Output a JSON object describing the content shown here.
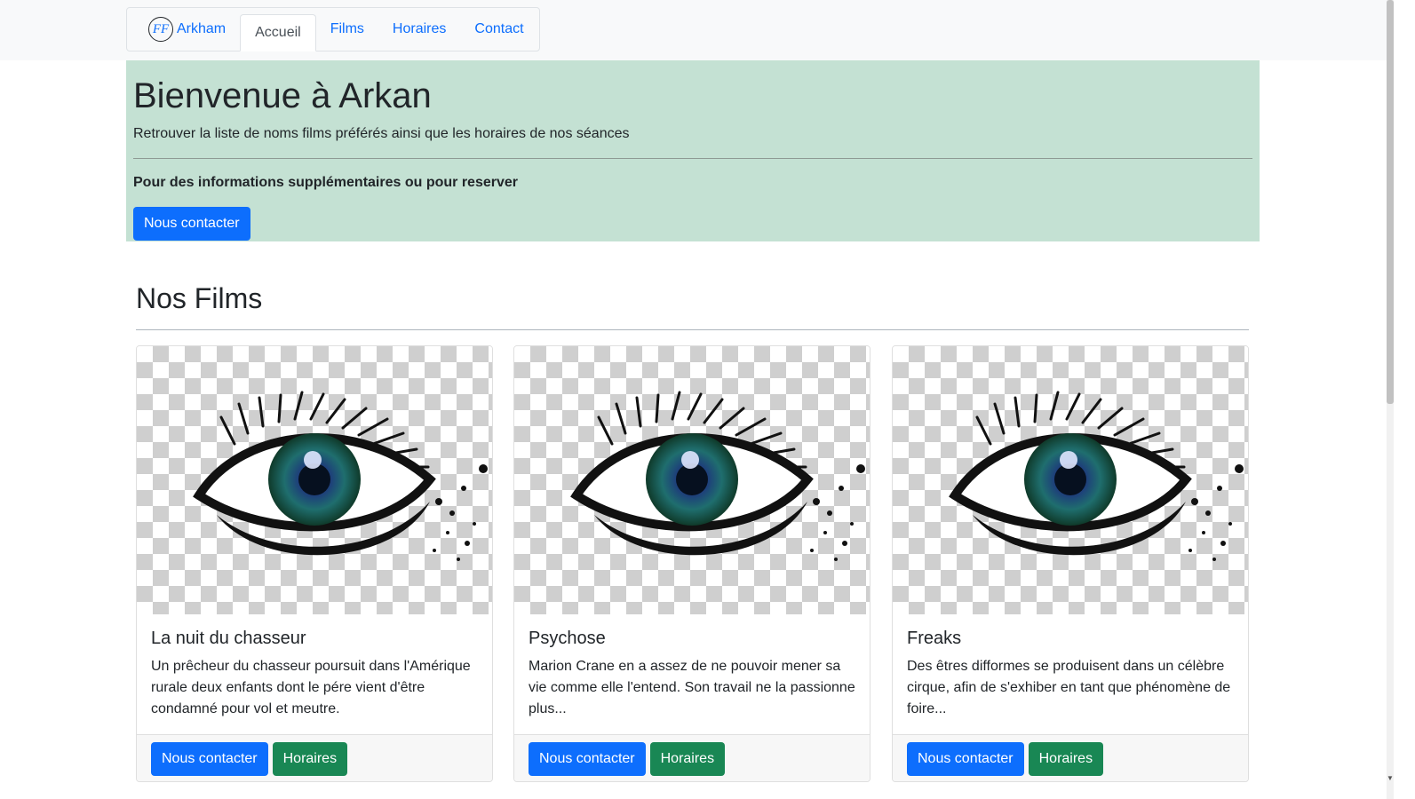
{
  "nav": {
    "brand_logo": "FF",
    "brand_label": "Arkham",
    "links": [
      "Accueil",
      "Films",
      "Horaires",
      "Contact"
    ]
  },
  "hero": {
    "title": "Bienvenue à Arkan",
    "lead": "Retrouver la liste de noms films préférés ainsi que les horaires de nos séances",
    "info": "Pour des informations supplémentaires ou pour reserver",
    "button": "Nous contacter",
    "background_color": "#c4e1d3"
  },
  "films_section": {
    "title": "Nos Films",
    "cards": [
      {
        "title": "La nuit du chasseur",
        "text": "Un prêcheur du chasseur poursuit dans l'Amérique rurale deux enfants dont le pére vient d'être condamné pour vol et meutre.",
        "contact_button": "Nous contacter",
        "schedule_button": "Horaires",
        "image_icon": "eye-image"
      },
      {
        "title": "Psychose",
        "text": "Marion Crane en a assez de ne pouvoir mener sa vie comme elle l'entend. Son travail ne la passionne plus...",
        "contact_button": "Nous contacter",
        "schedule_button": "Horaires",
        "image_icon": "eye-image"
      },
      {
        "title": "Freaks",
        "text": "Des êtres difformes se produisent dans un célèbre cirque, afin de s'exhiber en tant que phénomène de foire...",
        "contact_button": "Nous contacter",
        "schedule_button": "Horaires",
        "image_icon": "eye-image"
      }
    ]
  },
  "colors": {
    "primary": "#0d6efd",
    "success": "#198754",
    "hero_bg": "#c4e1d3"
  }
}
